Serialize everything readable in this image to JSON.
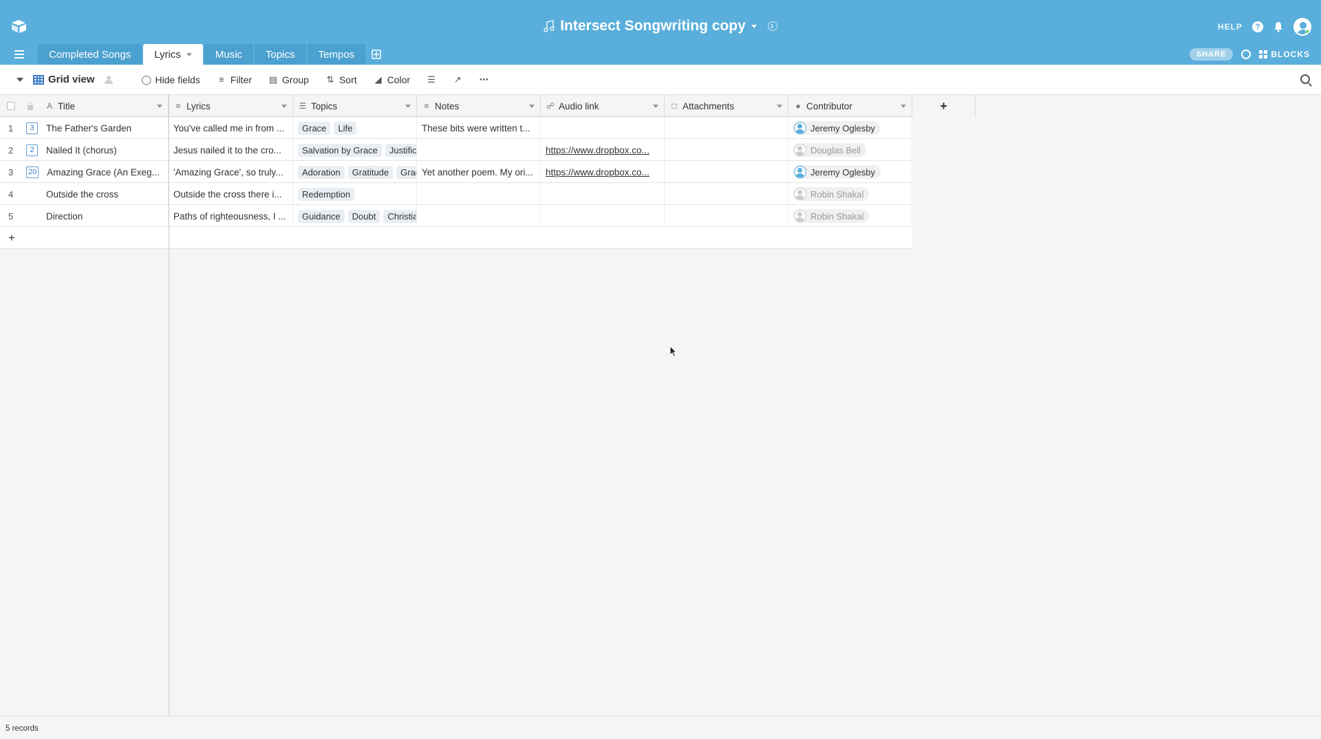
{
  "app": {
    "base_title": "Intersect Songwriting copy",
    "help_label": "HELP",
    "share_label": "SHARE",
    "blocks_label": "BLOCKS"
  },
  "tabs": [
    {
      "label": "Completed Songs",
      "active": false
    },
    {
      "label": "Lyrics",
      "active": true
    },
    {
      "label": "Music",
      "active": false
    },
    {
      "label": "Topics",
      "active": false
    },
    {
      "label": "Tempos",
      "active": false
    }
  ],
  "toolbar": {
    "view_name": "Grid view",
    "hide_fields": "Hide fields",
    "filter": "Filter",
    "group": "Group",
    "sort": "Sort",
    "color": "Color"
  },
  "columns": [
    {
      "label": "Title",
      "icon": "text-icon"
    },
    {
      "label": "Lyrics",
      "icon": "long-text-icon"
    },
    {
      "label": "Topics",
      "icon": "link-icon"
    },
    {
      "label": "Notes",
      "icon": "long-text-icon"
    },
    {
      "label": "Audio link",
      "icon": "url-icon"
    },
    {
      "label": "Attachments",
      "icon": "attachment-icon"
    },
    {
      "label": "Contributor",
      "icon": "user-icon"
    }
  ],
  "rows": [
    {
      "num": "1",
      "badge": "3",
      "title": "The Father's Garden",
      "lyrics": "You've called me in from ...",
      "topics": [
        "Grace",
        "Life"
      ],
      "notes": "These bits were written t...",
      "audio": "",
      "contributor": "Jeremy Oglesby",
      "contributor_active": true
    },
    {
      "num": "2",
      "badge": "2",
      "title": "Nailed It (chorus)",
      "lyrics": "Jesus nailed it to the cro...",
      "topics": [
        "Salvation by Grace",
        "Justific"
      ],
      "notes": "",
      "audio": "https://www.dropbox.co...",
      "contributor": "Douglas Bell",
      "contributor_active": false
    },
    {
      "num": "3",
      "badge": "20",
      "title": "Amazing Grace (An Exeg...",
      "lyrics": "'Amazing Grace', so truly...",
      "topics": [
        "Adoration",
        "Gratitude",
        "Grac"
      ],
      "notes": "Yet another poem. My ori...",
      "audio": "https://www.dropbox.co...",
      "contributor": "Jeremy Oglesby",
      "contributor_active": true
    },
    {
      "num": "4",
      "badge": "",
      "title": "Outside the cross",
      "lyrics": "Outside the cross there i...",
      "topics": [
        "Redemption"
      ],
      "notes": "",
      "audio": "",
      "contributor": "Robin Shakal",
      "contributor_active": false
    },
    {
      "num": "5",
      "badge": "",
      "title": "Direction",
      "lyrics": "Paths of righteousness, I ...",
      "topics": [
        "Guidance",
        "Doubt",
        "Christiar"
      ],
      "notes": "",
      "audio": "",
      "contributor": "Robin Shakal",
      "contributor_active": false
    }
  ],
  "footer": {
    "record_count": "5 records"
  },
  "colors": {
    "header_bg": "#59aedb",
    "tab_inactive": "#4aa0cf",
    "accent": "#3b7ac4"
  }
}
